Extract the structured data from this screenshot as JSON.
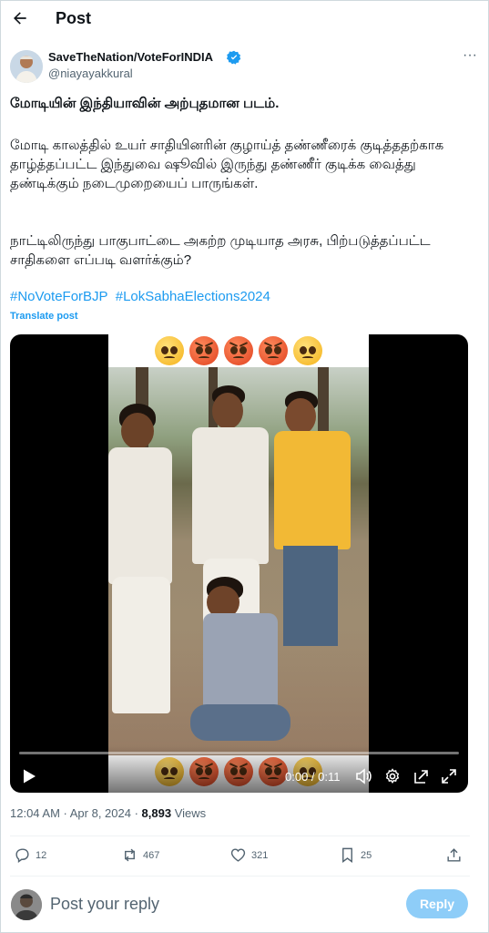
{
  "header": {
    "title": "Post"
  },
  "author": {
    "display_name": "SaveTheNation/VoteForINDIA",
    "handle": "@niayayakkural",
    "verified": true
  },
  "post": {
    "headline": "மோடியின் இந்தியாவின் அற்புதமான படம்.",
    "paragraph1": "மோடி காலத்தில் உயர் சாதியினரின் குழாய்த் தண்ணீரைக் குடித்ததற்காக தாழ்த்தப்பட்ட இந்துவை ஷூவில் இருந்து தண்ணீர் குடிக்க வைத்து தண்டிக்கும் நடைமுறையைப் பாருங்கள்.",
    "paragraph2": "நாட்டிலிருந்து பாகுபாட்டை அகற்ற முடியாத அரசு, பிற்படுத்தப்பட்ட சாதிகளை எப்படி வளர்க்கும்?",
    "hashtags": [
      "#NoVoteForBJP",
      "#LokSabhaElections2024"
    ],
    "translate_label": "Translate post"
  },
  "video": {
    "timecode": "0:00 / 0:11",
    "progress": 0.0,
    "emoji_top": [
      "pleading-face",
      "angry-face",
      "angry-face",
      "angry-face",
      "pleading-face"
    ],
    "emoji_bottom": [
      "pleading-face",
      "angry-face",
      "angry-face",
      "angry-face",
      "pleading-face"
    ]
  },
  "meta": {
    "time": "12:04 AM · Apr 8, 2024 · ",
    "views_count": "8,893",
    "views_label": " Views"
  },
  "actions": {
    "replies": "12",
    "reposts": "467",
    "likes": "321",
    "bookmarks": "25"
  },
  "reply": {
    "placeholder": "Post your reply",
    "button_label": "Reply"
  },
  "colors": {
    "accent": "#1d9bf0",
    "reply_button_disabled": "#8ecdf8",
    "secondary_text": "#536471"
  }
}
